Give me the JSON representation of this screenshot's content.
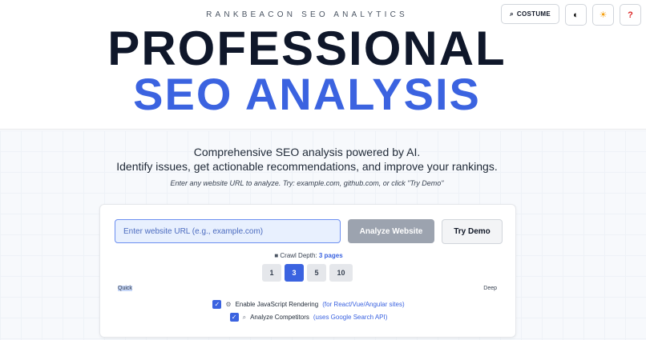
{
  "header": {
    "brand": "RANKBEACON SEO ANALYTICS",
    "title_line1": "PROFESSIONAL",
    "title_line2": "SEO ANALYSIS"
  },
  "top_actions": {
    "costume_icon": "⌕",
    "costume_label": "COSTUME",
    "theme_icon": "◐",
    "bulb_icon": "☀",
    "help_icon": "?"
  },
  "tagline": {
    "line1": "Comprehensive SEO analysis powered by AI.",
    "line2": "Identify issues, get actionable recommendations, and improve your rankings."
  },
  "hint": "Enter any website URL to analyze. Try: example.com, github.com, or click \"Try Demo\"",
  "form": {
    "url_placeholder": "Enter website URL (e.g., example.com)",
    "url_value": "",
    "analyze_label": "Analyze Website",
    "demo_label": "Try Demo"
  },
  "crawl": {
    "label_icon": "■",
    "label": "Crawl Depth:",
    "value": "3 pages",
    "options": [
      "1",
      "3",
      "5",
      "10"
    ],
    "selected": "3",
    "min_label": "Quick",
    "max_label": "Deep"
  },
  "options": {
    "js_icon": "⚙",
    "js_label": "Enable JavaScript Rendering",
    "js_note": "(for React/Vue/Angular sites)",
    "js_checked": true,
    "comp_icon": "⌕",
    "comp_label": "Analyze Competitors",
    "comp_note": "(uses Google Search API)",
    "comp_checked": true
  },
  "colors": {
    "accent": "#3b63e0",
    "title_dark": "#0f172a",
    "disabled_button": "#9ca3af"
  }
}
